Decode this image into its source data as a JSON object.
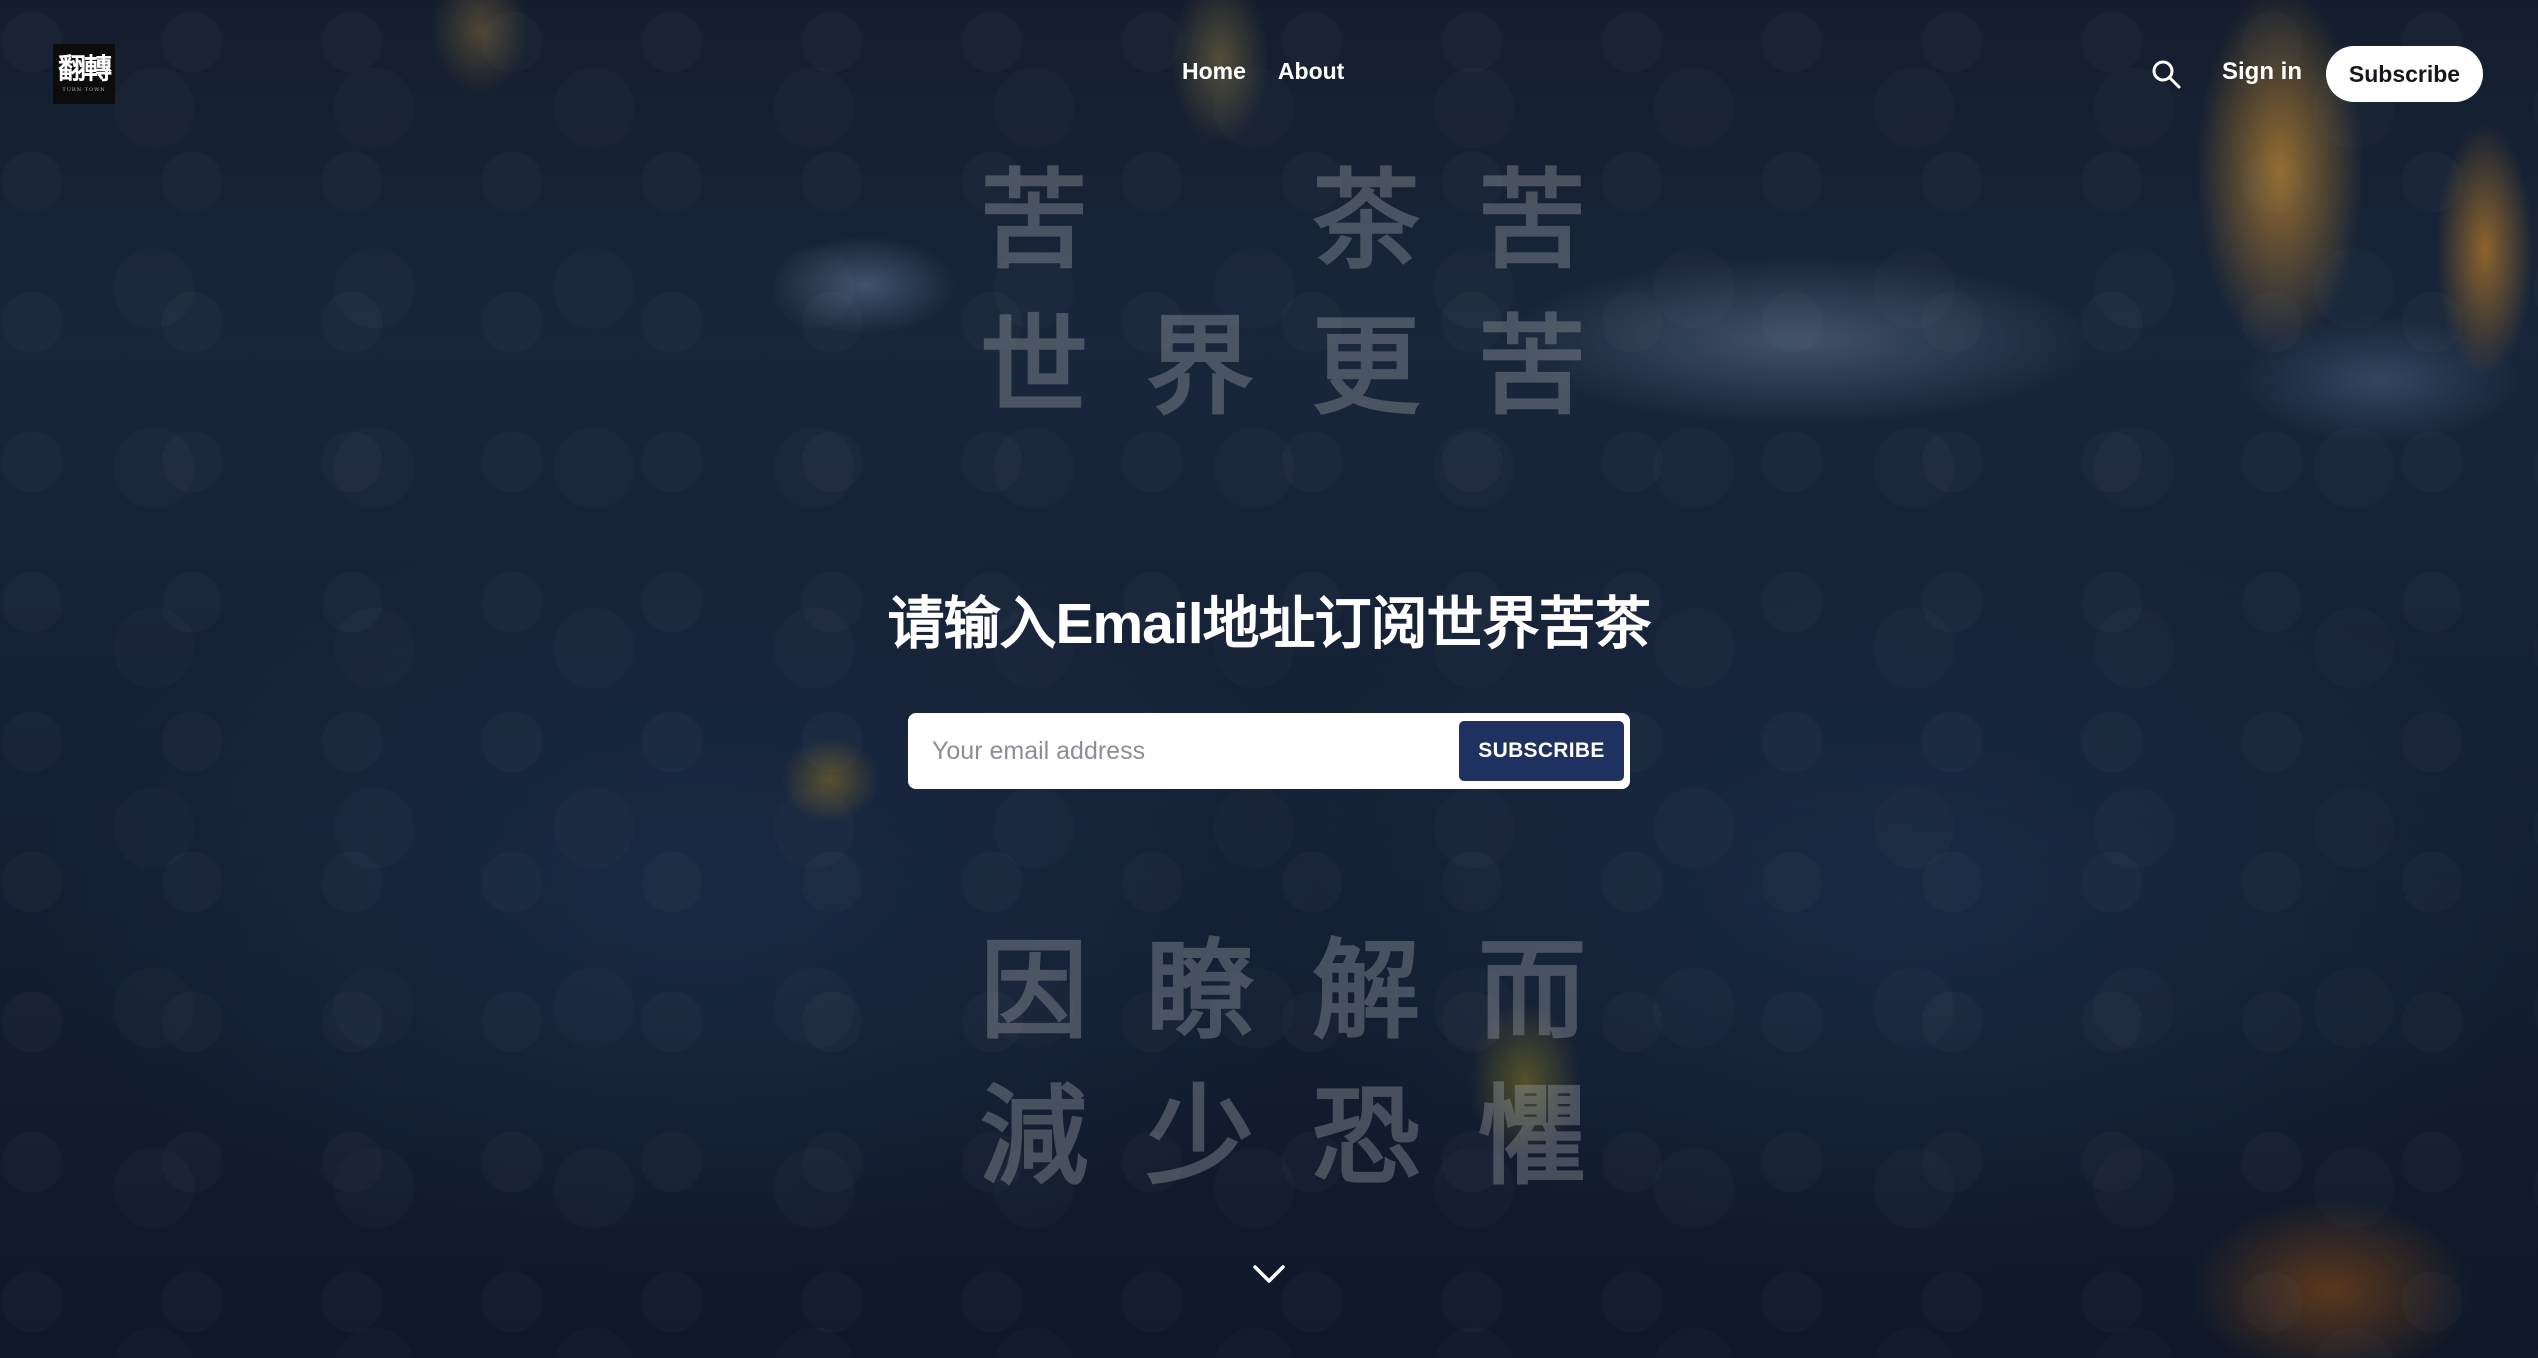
{
  "brand": {
    "logo_mark": "翻轉",
    "logo_sub": "TURN·TOWN"
  },
  "nav": {
    "items": [
      {
        "label": "Home"
      },
      {
        "label": "About"
      }
    ]
  },
  "header": {
    "signin_label": "Sign in",
    "subscribe_label": "Subscribe",
    "search_icon": "search-icon"
  },
  "poem": {
    "top_rows": [
      [
        "苦",
        "",
        "茶",
        "苦"
      ],
      [
        "世",
        "界",
        "更",
        "苦"
      ]
    ],
    "bottom_rows": [
      [
        "因",
        "瞭",
        "解",
        "而"
      ],
      [
        "減",
        "少",
        "恐",
        "懼"
      ]
    ]
  },
  "hero": {
    "title": "请输入Email地址订阅世界苦茶",
    "email_placeholder": "Your email address",
    "subscribe_button": "SUBSCRIBE"
  },
  "scroll": {
    "icon": "chevron-down-icon"
  },
  "colors": {
    "button_bg": "#1e3160",
    "pill_bg": "#ffffff"
  }
}
